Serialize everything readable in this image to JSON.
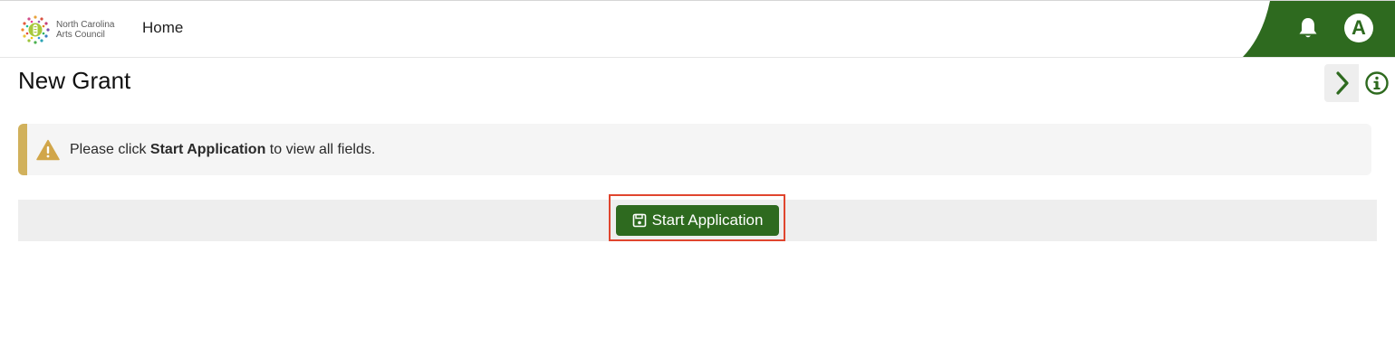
{
  "header": {
    "logo": {
      "line1": "North Carolina",
      "line2": "Arts Council"
    },
    "nav_home": "Home",
    "avatar_initial": "A",
    "bell_icon": "bell-icon",
    "accent_color": "#2e6a1f"
  },
  "page": {
    "title": "New Grant"
  },
  "side_controls": {
    "chevron_icon": "chevron-right-icon",
    "info_icon": "info-circle-icon"
  },
  "alert": {
    "icon": "warning-icon",
    "prefix": "Please click ",
    "bold": "Start Application",
    "suffix": " to view all fields.",
    "border_color": "#d1b15c"
  },
  "actions": {
    "start_label": "Start Application",
    "start_icon": "save-icon",
    "highlight_color": "#e0452e"
  }
}
